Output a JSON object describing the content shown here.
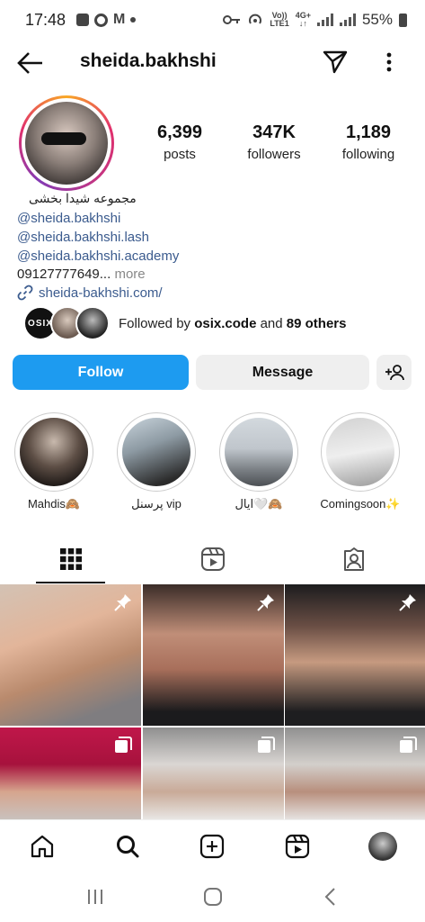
{
  "status_bar": {
    "time": "17:48",
    "network_label_top": "Vo))",
    "network_label_bottom": "LTE1",
    "network_type_top": "4G+",
    "network_type_bottom": "↓↑",
    "battery": "55%"
  },
  "header": {
    "username": "sheida.bakhshi"
  },
  "stats": [
    {
      "value": "6,399",
      "label": "posts"
    },
    {
      "value": "347K",
      "label": "followers"
    },
    {
      "value": "1,189",
      "label": "following"
    }
  ],
  "bio": {
    "name": "مجموعه شیدا بخشی",
    "links": [
      "@sheida.bakhshi",
      "@sheida.bakhshi.lash",
      "@sheida.bakhshi.academy"
    ],
    "phone": "09127777649...",
    "more": " more",
    "website": "sheida-bakhshi.com/"
  },
  "followed_by": {
    "prefix": "Followed by ",
    "user": "osix.code",
    "middle": " and ",
    "others": "89 others",
    "badge_text": "OSIX"
  },
  "buttons": {
    "follow": "Follow",
    "message": "Message"
  },
  "highlights": [
    {
      "label": "Mahdis🙈"
    },
    {
      "label": "پرسنل vip"
    },
    {
      "label": "ایال🤍🙈"
    },
    {
      "label": "Comingsoon✨"
    }
  ],
  "colors": {
    "accent_blue": "#1d9bf0",
    "link_blue": "#3b5b8e"
  }
}
